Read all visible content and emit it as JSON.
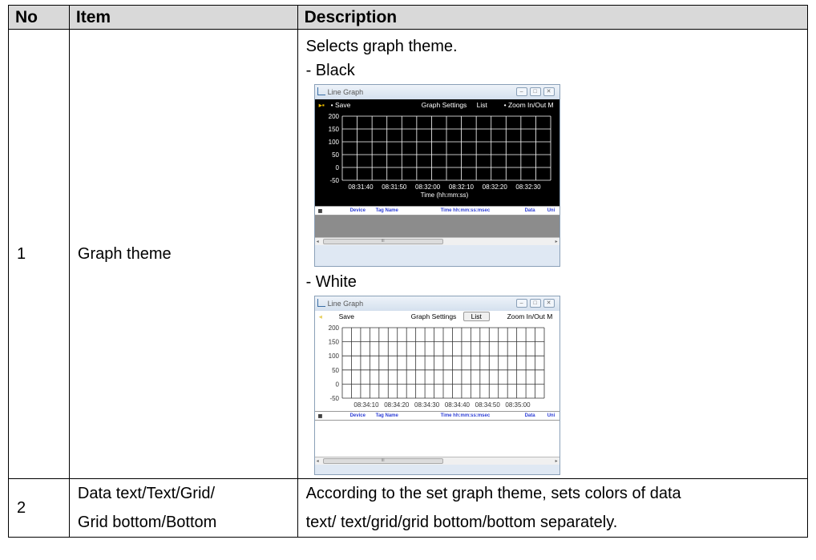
{
  "headers": {
    "no": "No",
    "item": "Item",
    "description": "Description"
  },
  "rows": [
    {
      "no": "1",
      "item": "Graph theme",
      "desc_intro": "Selects graph theme.",
      "black_label": "- Black",
      "white_label": "- White"
    },
    {
      "no": "2",
      "item_line1": "Data text/Text/Grid/",
      "item_line2": "Grid bottom/Bottom",
      "desc_line1": "According to the set graph theme, sets colors of data",
      "desc_line2": "text/ text/grid/grid bottom/bottom separately."
    }
  ],
  "screens": {
    "black": {
      "window_title": "Line Graph",
      "toolbar": {
        "save": "Save",
        "graph_settings": "Graph Settings",
        "list": "List",
        "zoom": "Zoom In/Out M"
      },
      "y_ticks": [
        "200",
        "150",
        "100",
        "50",
        "0",
        "-50"
      ],
      "x_ticks": [
        "08:31:40",
        "08:31:50",
        "08:32:00",
        "08:32:10",
        "08:32:20",
        "08:32:30"
      ],
      "x_title": "Time (hh:mm:ss)",
      "columns": [
        "Device",
        "Tag Name",
        "Time hh:mm:ss:msec",
        "Data",
        "Uni"
      ]
    },
    "white": {
      "window_title": "Line Graph",
      "toolbar": {
        "save": "Save",
        "graph_settings": "Graph Settings",
        "list": "List",
        "zoom": "Zoom In/Out M"
      },
      "y_ticks": [
        "200",
        "150",
        "100",
        "50",
        "0",
        "-50"
      ],
      "x_ticks": [
        "08:34:10",
        "08:34:20",
        "08:34:30",
        "08:34:40",
        "08:34:50",
        "08:35:00"
      ],
      "columns": [
        "Device",
        "Tag Name",
        "Time hh:mm:ss:msec",
        "Data",
        "Uni"
      ]
    }
  },
  "scrollbar_grip": "III",
  "colors": {
    "header_bg": "#d9d9d9",
    "black_bg": "#000000",
    "list_header_text": "#2e3fd6",
    "list_body_black": "#8c8c8c"
  }
}
